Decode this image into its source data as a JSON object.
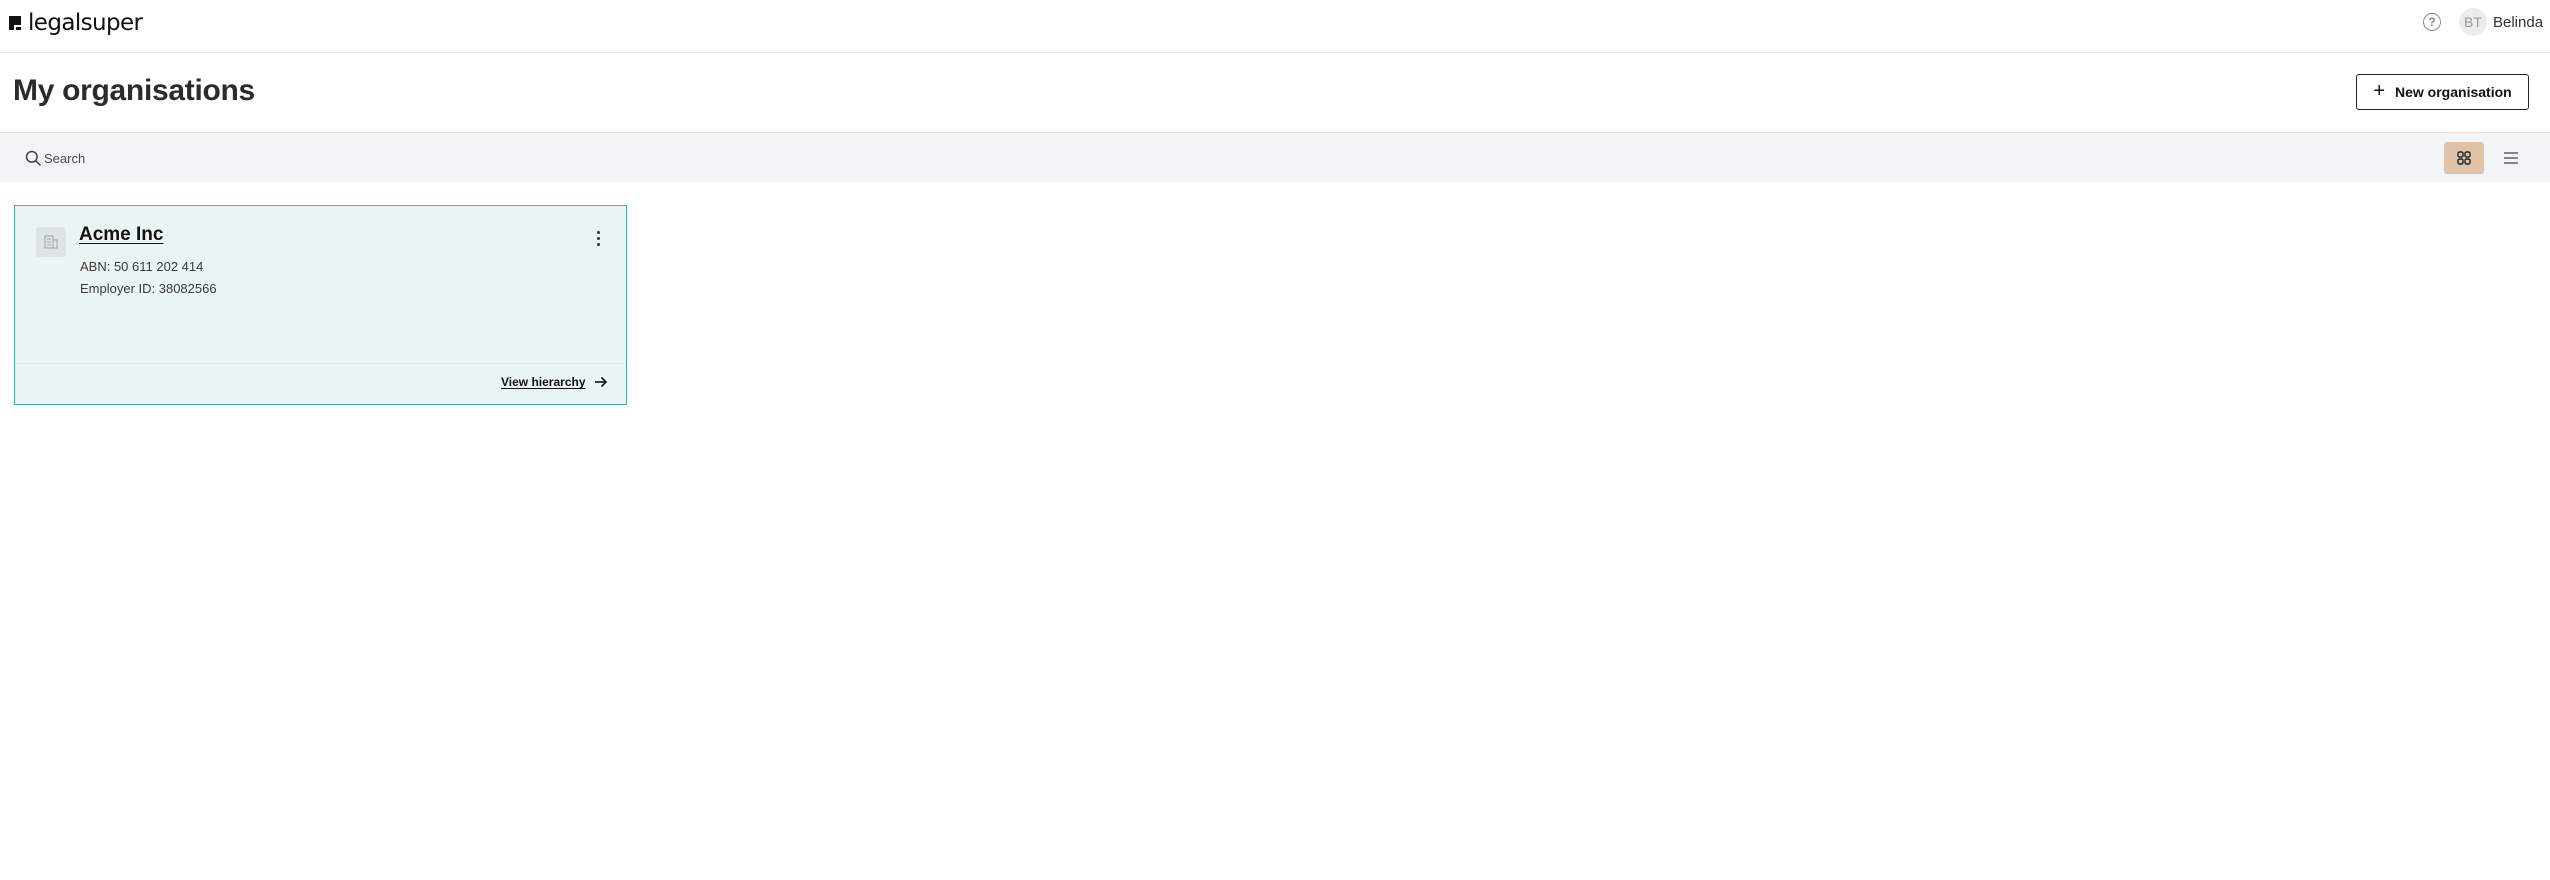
{
  "header": {
    "logo_text": "legalsuper",
    "avatar_initials": "BT",
    "user_name": "Belinda",
    "help_glyph": "?"
  },
  "page": {
    "title": "My organisations",
    "new_button_label": "New organisation",
    "new_button_icon": "plus-icon"
  },
  "search": {
    "placeholder": "Search",
    "value": ""
  },
  "view_toggle": {
    "active": "grid",
    "options": [
      "grid",
      "list"
    ],
    "active_color": "#dec3a8"
  },
  "organisations": [
    {
      "name": "Acme Inc",
      "abn": "ABN: 50 611 202 414",
      "employer_id": "Employer ID: 38082566",
      "link_label": "View hierarchy"
    }
  ],
  "colors": {
    "card_border": "#4fa9ad",
    "card_bg": "#eaf5f3",
    "searchbar_bg": "#f3f4f5"
  }
}
